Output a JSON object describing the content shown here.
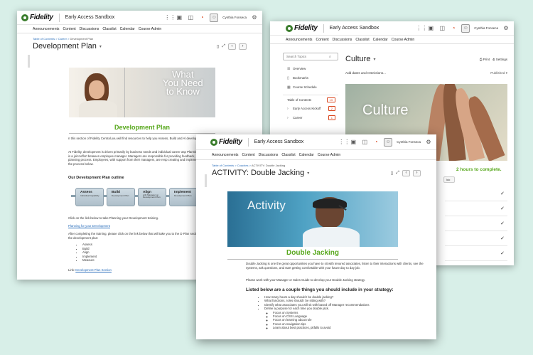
{
  "common": {
    "brand": "Fidelity",
    "course": "Early Access Sandbox",
    "user": "Cynthia Fonseca",
    "nav": [
      "Announcements",
      "Content",
      "Discussions",
      "Classlist",
      "Calendar",
      "Course Admin"
    ]
  },
  "w1": {
    "breadcrumb": [
      "Table of Contents",
      "Career",
      "Development Plan"
    ],
    "title": "Development Plan",
    "banner_text": [
      "What",
      "You Need",
      "to Know"
    ],
    "heading": "Development Plan",
    "para1": "n this section of Fidelity Central you will find resources to help you Assess, Build and Al development plan.",
    "para2": "At Fidelity, development is driven primarily by business needs and individual career asp Planning for and pursuing development opportunities is a joint effort between employee manager. Managers are responsible for providing feedback, coaching, and approval thro development planning process. Employees, with support from their managers, are resp creating and implementing actionable development plans, following the process below.",
    "outline_heading": "Our Development Plan outline",
    "steps": [
      {
        "label": "Assess",
        "sub": "Individual Capability"
      },
      {
        "label": "Build",
        "sub": "Development Plan"
      },
      {
        "label": "Align",
        "sub": "with Manager on Development Plan"
      },
      {
        "label": "Implement",
        "sub": "Development Plan"
      },
      {
        "label": "Measu",
        "sub": "Progress"
      }
    ],
    "click_text": "Click on the link below to take Planning your Development training.",
    "link1": "Planning for your Development",
    "after_text": "After completing the training, please click on the link below that will take you to the D Plan section and take a deep dive into each process of the development plan:",
    "list": [
      "Assess",
      "Build",
      "Align",
      "Implement",
      "Measure"
    ],
    "link_label": "Link:",
    "link2": "Development Plan Section"
  },
  "w2": {
    "search_placeholder": "Search Topics",
    "sidebar": [
      {
        "icon": "overview-icon",
        "label": "Overview",
        "badge": ""
      },
      {
        "icon": "bookmark-icon",
        "label": "Bookmarks",
        "badge": ""
      },
      {
        "icon": "schedule-icon",
        "label": "Course Schedule",
        "badge": ""
      },
      {
        "icon": "",
        "label": "Table of Contents",
        "badge": "13"
      },
      {
        "icon": "arrow-icon",
        "label": "Early Access Kickoff",
        "badge": "2"
      },
      {
        "icon": "arrow-icon",
        "label": "Career",
        "badge": "1"
      }
    ],
    "title": "Culture",
    "print": "Print",
    "settings": "Settings",
    "add_dates": "Add dates and restrictions...",
    "published": "Published",
    "banner_text": "Culture",
    "hours_text": "2 hours to complete.",
    "button_text": "ldo",
    "check_rows": 5
  },
  "w3": {
    "breadcrumb": [
      "Table of Contents",
      "Coaches",
      "ACTIVITY: Double Jacking"
    ],
    "title": "ACTIVITY: Double Jacking",
    "banner_text": "Activity",
    "heading": "Double Jacking",
    "para1": "Double Jacking is one the great opportunities you have to sit with tenured associates, listen to their interactions with clients, see the systems, ask questions, and start getting comfortable with your future day to day job.",
    "para2": "Please work with your Manager or Sales Guide to develop your Double Jacking strategy.",
    "list_heading": "Listed below are a couple things you should include in your strategy:",
    "items": [
      "How many hours a day should I be double jacking?",
      "What functions, roles should I be sitting with?",
      "Identify what associates you will sit with based off Manager recommendations",
      "Define a purpose for each time you double jack."
    ],
    "subitems": [
      "Focus on Systems",
      "Focus on CSS Language",
      "Focus on learning about role",
      "Focus on navigation tips",
      "Learn about best practices, pitfalls to avoid"
    ]
  }
}
